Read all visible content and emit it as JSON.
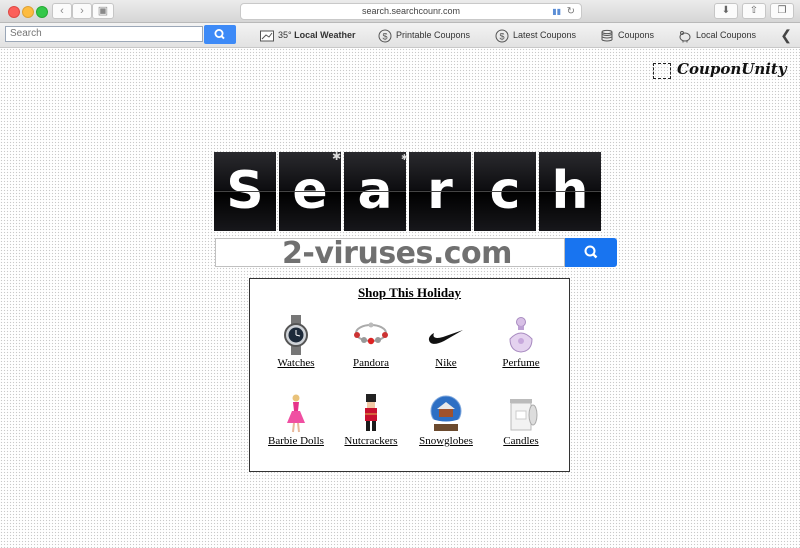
{
  "browser": {
    "url": "search.searchcounr.com"
  },
  "toolbar": {
    "search_placeholder": "Search",
    "items": [
      {
        "label": "Local Weather",
        "prefix": "35°",
        "icon": "weather-icon"
      },
      {
        "label": "Printable Coupons",
        "icon": "dollar-circle-icon"
      },
      {
        "label": "Latest Coupons",
        "icon": "dollar-circle-icon"
      },
      {
        "label": "Coupons",
        "icon": "coin-stack-icon"
      },
      {
        "label": "Local Coupons",
        "icon": "piggy-bank-icon"
      }
    ]
  },
  "brand": {
    "name": "CouponUnity"
  },
  "logo": {
    "letters": [
      "S",
      "e",
      "a",
      "r",
      "c",
      "h"
    ]
  },
  "watermark": "2-viruses.com",
  "shop": {
    "title": "Shop This Holiday",
    "products": [
      {
        "label": "Watches",
        "icon": "watch-icon"
      },
      {
        "label": "Pandora",
        "icon": "bracelet-icon"
      },
      {
        "label": "Nike",
        "icon": "nike-swoosh-icon"
      },
      {
        "label": "Perfume",
        "icon": "perfume-bottle-icon"
      },
      {
        "label": "Barbie Dolls",
        "icon": "doll-icon"
      },
      {
        "label": "Nutcrackers",
        "icon": "nutcracker-icon"
      },
      {
        "label": "Snowglobes",
        "icon": "snowglobe-icon"
      },
      {
        "label": "Candles",
        "icon": "candle-icon"
      }
    ]
  },
  "colors": {
    "accent": "#1874f0",
    "toolbar_button": "#3d8af7"
  }
}
